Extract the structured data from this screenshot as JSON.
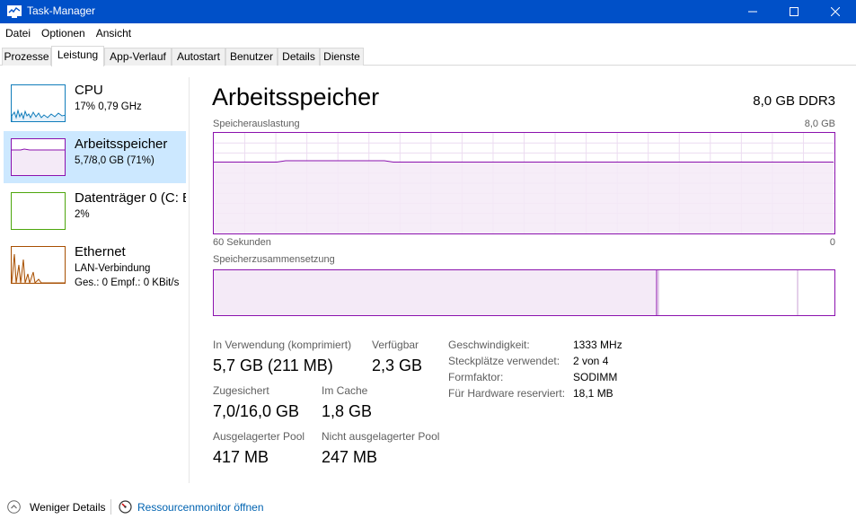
{
  "window": {
    "title": "Task-Manager"
  },
  "menu": [
    "Datei",
    "Optionen",
    "Ansicht"
  ],
  "tabs": [
    "Prozesse",
    "Leistung",
    "App-Verlauf",
    "Autostart",
    "Benutzer",
    "Details",
    "Dienste"
  ],
  "sidebar": {
    "cpu": {
      "name": "CPU",
      "sub": "17% 0,79 GHz",
      "color": "#117dbb"
    },
    "memory": {
      "name": "Arbeitsspeicher",
      "sub": "5,7/8,0 GB (71%)",
      "color": "#8b12ae"
    },
    "disk": {
      "name": "Datenträger 0 (C: E",
      "sub": "2%",
      "color": "#4da60c"
    },
    "ethernet": {
      "name": "Ethernet",
      "sub": "LAN-Verbindung",
      "detail": "Ges.: 0 Empf.: 0 KBit/s",
      "color": "#a74f01"
    }
  },
  "main": {
    "title": "Arbeitsspeicher",
    "spec": "8,0 GB DDR3",
    "usage_label": "Speicherauslastung",
    "usage_max": "8,0 GB",
    "time_left": "60 Sekunden",
    "time_right": "0",
    "composition_label": "Speicherzusammensetzung",
    "usage_fraction": 0.71,
    "stats": {
      "in_use_label": "In Verwendung (komprimiert)",
      "in_use_value": "5,7 GB (211 MB)",
      "available_label": "Verfügbar",
      "available_value": "2,3 GB",
      "committed_label": "Zugesichert",
      "committed_value": "7,0/16,0 GB",
      "cached_label": "Im Cache",
      "cached_value": "1,8 GB",
      "paged_label": "Ausgelagerter Pool",
      "paged_value": "417 MB",
      "nonpaged_label": "Nicht ausgelagerter Pool",
      "nonpaged_value": "247 MB"
    },
    "details": {
      "speed_label": "Geschwindigkeit:",
      "speed_value": "1333 MHz",
      "slots_label": "Steckplätze verwendet:",
      "slots_value": "2 von 4",
      "form_label": "Formfaktor:",
      "form_value": "SODIMM",
      "reserved_label": "Für Hardware reserviert:",
      "reserved_value": "18,1 MB"
    }
  },
  "footer": {
    "fewer_details": "Weniger Details",
    "resource_monitor": "Ressourcenmonitor öffnen"
  },
  "colors": {
    "titlebar": "#0050c8",
    "memory": "#8b12ae",
    "selected": "#cce8ff",
    "link": "#0063b1"
  }
}
